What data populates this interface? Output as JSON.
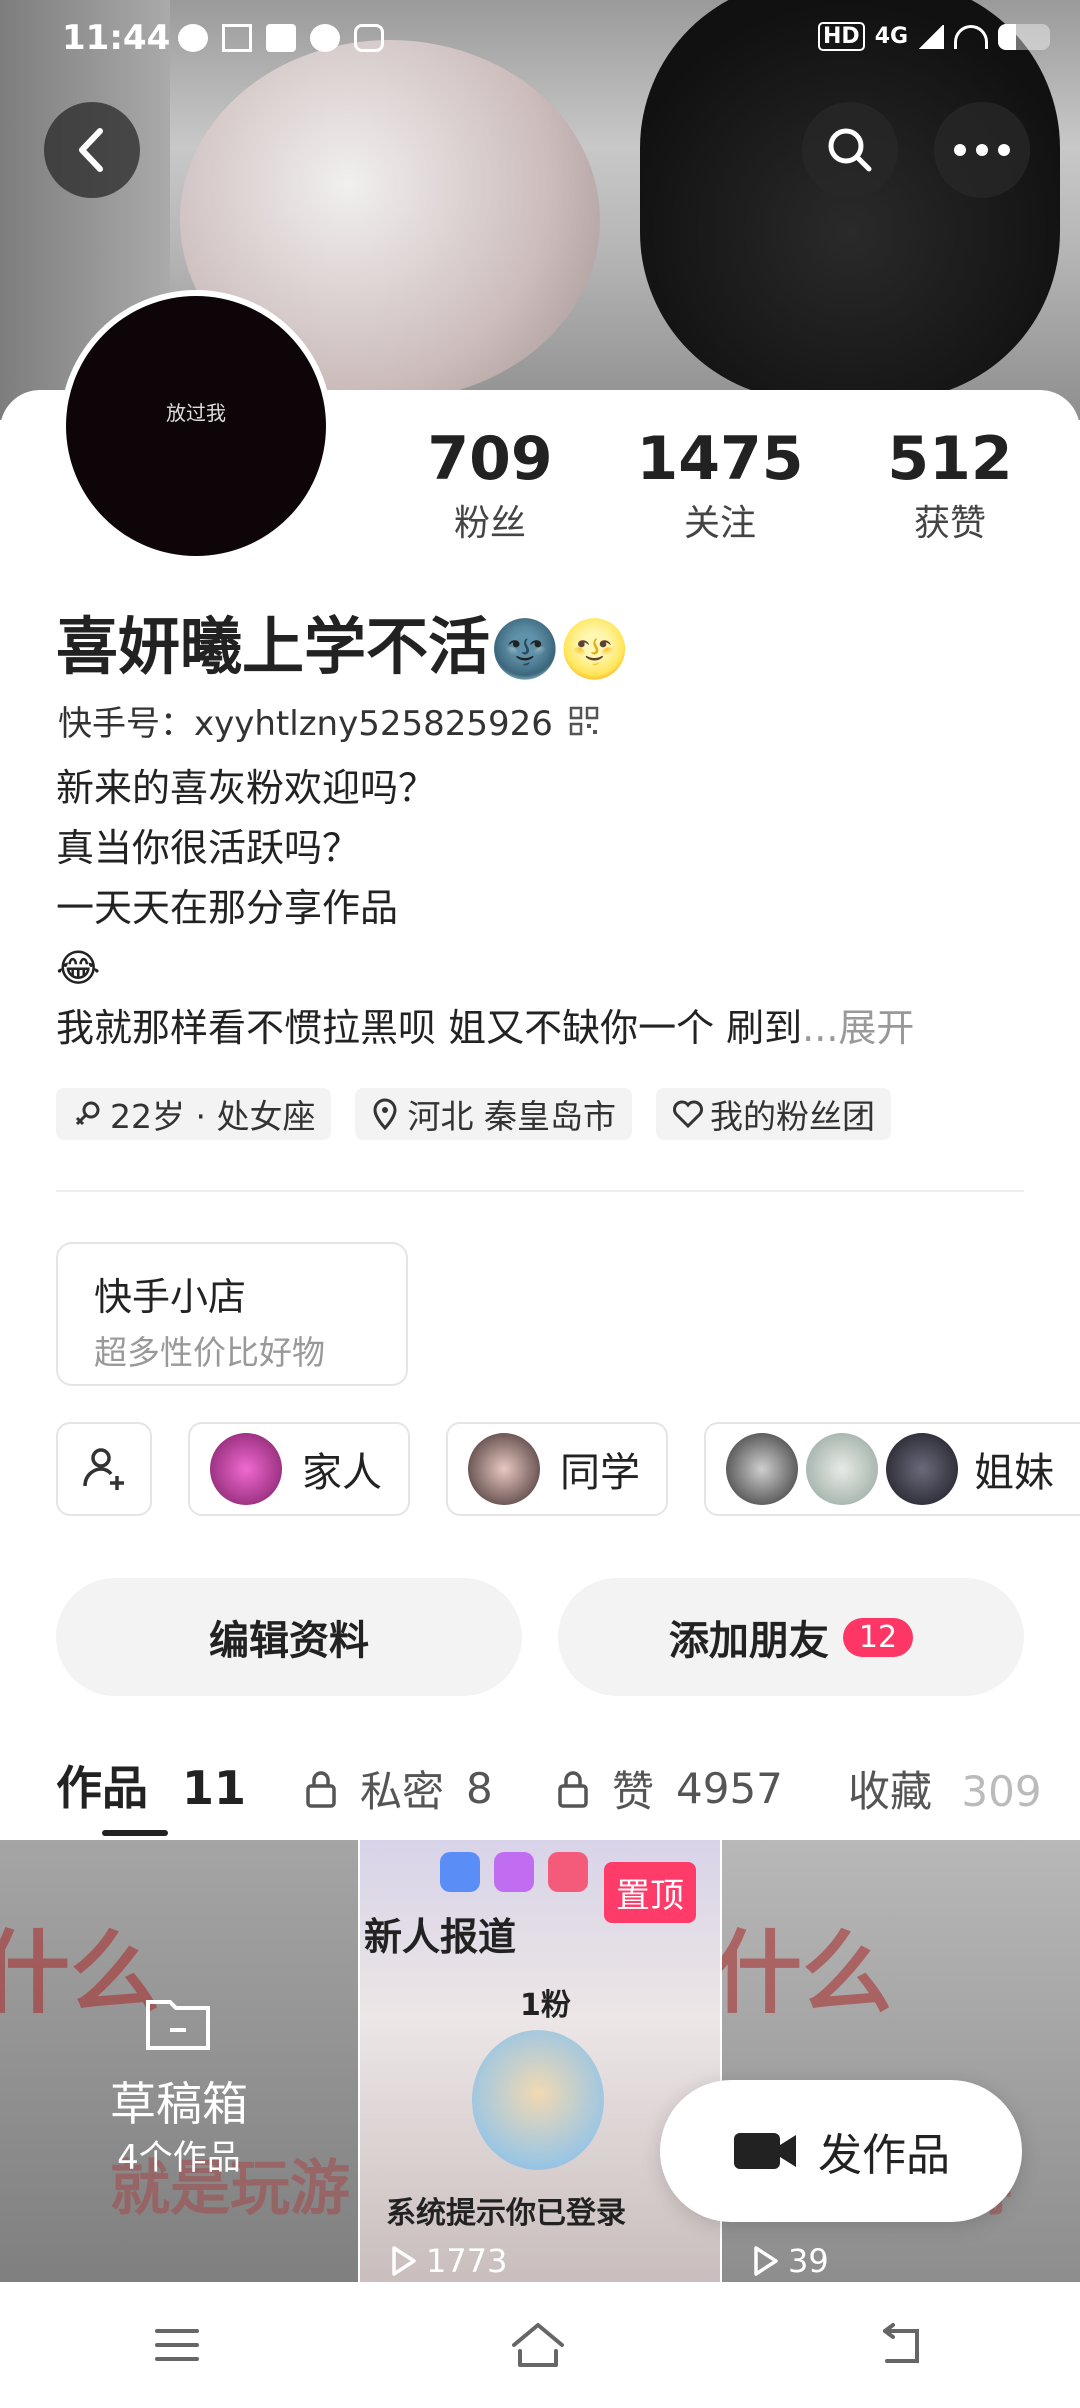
{
  "status_bar": {
    "time": "11:44",
    "network": "4G",
    "hd": "HD"
  },
  "header": {
    "back_icon": "chevron-left-icon",
    "search_icon": "search-icon",
    "more_icon": "more-dots-icon"
  },
  "profile": {
    "avatar_text": "放过我",
    "stats": [
      {
        "num": "709",
        "label": "粉丝"
      },
      {
        "num": "1475",
        "label": "关注"
      },
      {
        "num": "512",
        "label": "获赞"
      }
    ],
    "name": "喜妍曦上学不活",
    "name_emojis": "🌚🌝",
    "kuaishou_id": "快手号：xyyhtlzny525825926",
    "bio_lines": [
      "新来的喜灰粉欢迎吗？",
      "真当你很活跃吗？",
      "一天天在那分享作品",
      "😂"
    ],
    "bio_last": "我就那样看不惯拉黑呗  姐又不缺你一个  刷到",
    "bio_more": "...展开",
    "chips": [
      "22岁 · 处女座",
      "河北  秦皇岛市",
      "我的粉丝团"
    ]
  },
  "shop": {
    "title": "快手小店",
    "subtitle": "超多性价比好物"
  },
  "groups": [
    {
      "label": "家人"
    },
    {
      "label": "同学"
    },
    {
      "label": "姐妹"
    }
  ],
  "actions": {
    "edit": "编辑资料",
    "add_friend": "添加朋友",
    "friend_badge": "12"
  },
  "tabs": [
    {
      "label": "作品",
      "count": "11"
    },
    {
      "label": "私密",
      "count": "8"
    },
    {
      "label": "赞",
      "count": "4957"
    },
    {
      "label": "收藏",
      "count": "309"
    }
  ],
  "grid": {
    "draft_title": "草稿箱",
    "draft_count": "4个作品",
    "pinned": "置顶",
    "views_2": "1773",
    "views_3": "39",
    "thumb2_text_top": "新人报道",
    "thumb2_text_mid": "1粉",
    "thumb2_text_bottom": "系统提示你已登录"
  },
  "fab": {
    "label": "发作品"
  },
  "colors": {
    "accent": "#fe3666",
    "pinned": "#ff3b6a"
  }
}
